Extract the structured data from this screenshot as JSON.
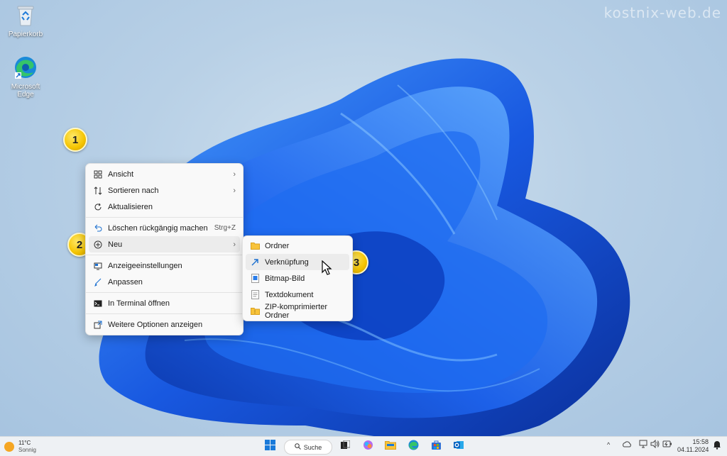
{
  "watermark": "kostnix-web.de",
  "desktop_icons": [
    {
      "label": "Papierkorb",
      "icon": "recycle-bin-icon"
    },
    {
      "label": "Microsoft Edge",
      "icon": "edge-icon"
    }
  ],
  "badges": [
    "1",
    "2",
    "3"
  ],
  "context_menu": {
    "items": [
      {
        "label": "Ansicht",
        "icon": "grid-icon",
        "submenu": true
      },
      {
        "label": "Sortieren nach",
        "icon": "sort-icon",
        "submenu": true
      },
      {
        "label": "Aktualisieren",
        "icon": "refresh-icon"
      },
      {
        "label": "Löschen rückgängig machen",
        "icon": "undo-icon",
        "shortcut": "Strg+Z"
      },
      {
        "label": "Neu",
        "icon": "plus-circle-icon",
        "submenu": true,
        "highlighted": true
      },
      {
        "label": "Anzeigeeinstellungen",
        "icon": "display-icon"
      },
      {
        "label": "Anpassen",
        "icon": "brush-icon"
      },
      {
        "label": "In Terminal öffnen",
        "icon": "terminal-icon"
      },
      {
        "label": "Weitere Optionen anzeigen",
        "icon": "more-options-icon"
      }
    ],
    "arrow": "›"
  },
  "submenu_new": {
    "items": [
      {
        "label": "Ordner",
        "icon": "folder-icon"
      },
      {
        "label": "Verknüpfung",
        "icon": "shortcut-arrow-icon",
        "highlighted": true
      },
      {
        "label": "Bitmap-Bild",
        "icon": "bitmap-icon"
      },
      {
        "label": "Textdokument",
        "icon": "text-document-icon"
      },
      {
        "label": "ZIP-komprimierter Ordner",
        "icon": "zip-folder-icon"
      }
    ]
  },
  "taskbar": {
    "weather_temp": "11°C",
    "weather_desc": "Sonnig",
    "search_label": "Suche",
    "time": "15:58",
    "date": "04.11.2024",
    "tray_chevron": "^"
  },
  "colors": {
    "accent": "#0067c0",
    "badge": "#f5c400",
    "bloom_dark": "#0a3fb8",
    "bloom_light": "#3b8cff"
  }
}
